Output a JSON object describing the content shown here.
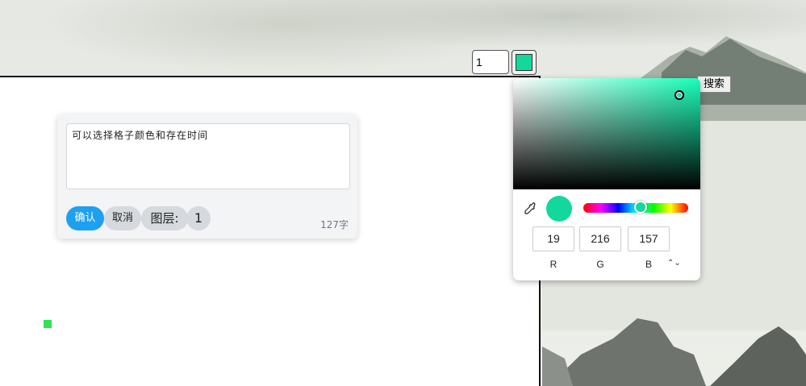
{
  "toolbar": {
    "layer_value": "1",
    "selected_color": "#13d89d",
    "search_label": "搜索"
  },
  "dialog": {
    "textarea_value": "可以选择格子颜色和存在时间",
    "confirm_label": "确认",
    "cancel_label": "取消",
    "layer_label": "图层:",
    "layer_number": "1",
    "char_count": "127字"
  },
  "color_picker": {
    "hex": "#13d89d",
    "r": "19",
    "g": "216",
    "b": "157",
    "r_label": "R",
    "g_label": "G",
    "b_label": "B",
    "mode_toggle_icon": "up-down-arrow-icon",
    "mode_toggle_symbol": "⌃⌄"
  },
  "canvas": {
    "cell_color": "#2ee452"
  }
}
